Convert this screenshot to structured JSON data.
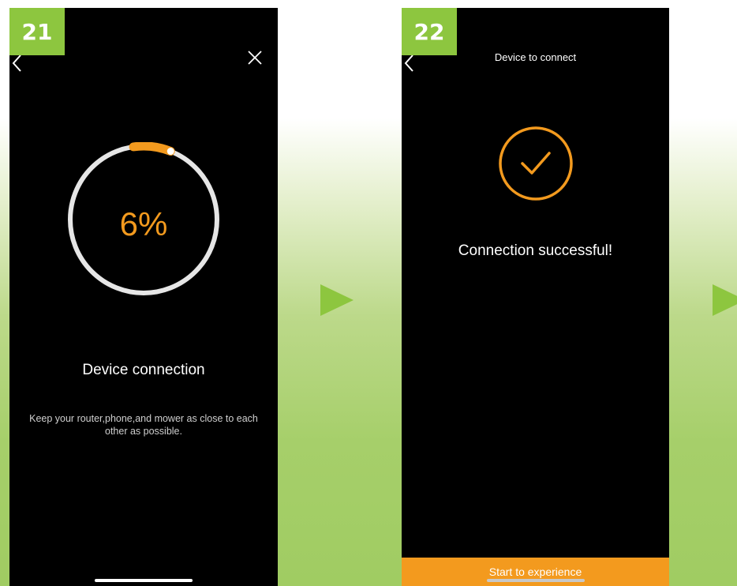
{
  "steps": [
    {
      "number": "21",
      "progress_percent": 6,
      "progress_label": "6%",
      "title": "Device connection",
      "subtitle": "Keep your router,phone,and mower as close to each other as possible."
    },
    {
      "number": "22",
      "header_title": "Device to connect",
      "title": "Connection successful!",
      "button_label": "Start to experience"
    }
  ],
  "colors": {
    "accent": "#f39a1e",
    "badge": "#8dc63f",
    "arrow": "#8dc63f",
    "track": "#e6e6e6"
  },
  "icons": [
    "back-icon",
    "close-icon",
    "check-icon",
    "next-arrow-icon"
  ]
}
